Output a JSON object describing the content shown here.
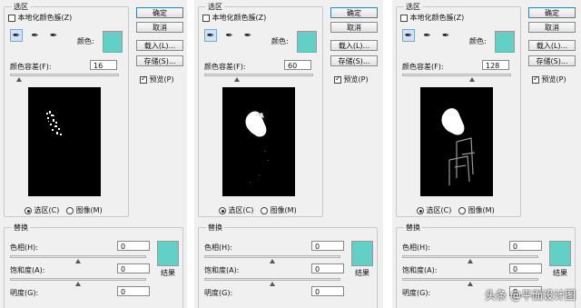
{
  "dialog": {
    "group_label": "选区",
    "localized_label": "本地化颜色簇(Z)",
    "color_label": "颜色:",
    "fuzziness_label": "颜色容差(F):",
    "selection_label": "选区(C)",
    "image_label": "图像(M)",
    "buttons": {
      "ok": "确定",
      "cancel": "取消",
      "load": "载入(L)...",
      "save": "存储(S)..."
    },
    "preview_label": "预览(P)",
    "replace": {
      "label": "替换",
      "hue_label": "色相(H):",
      "saturation_label": "饱和度(A):",
      "lightness_label": "明度(G):",
      "result_label": "结果",
      "hue": "0",
      "saturation": "0",
      "lightness": "0"
    },
    "tool_icons": [
      "eyedropper-icon",
      "eyedropper-plus-icon",
      "eyedropper-minus-icon"
    ],
    "swatch_color": "#63d0c8"
  },
  "panels": [
    {
      "fuzziness": "16"
    },
    {
      "fuzziness": "60"
    },
    {
      "fuzziness": "128"
    }
  ],
  "fuzziness_max": 200,
  "watermark": "头条 @平面设计图"
}
